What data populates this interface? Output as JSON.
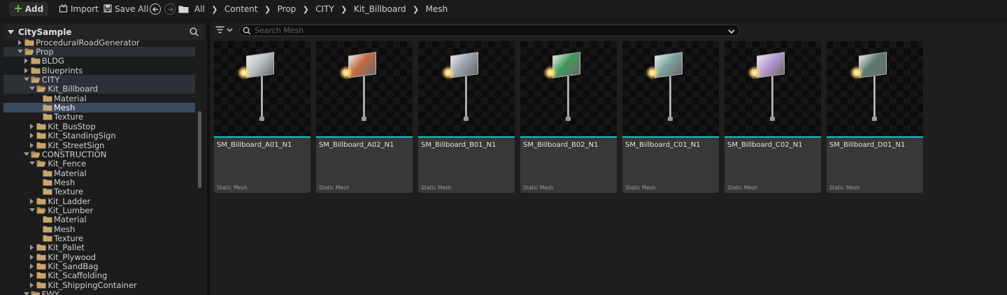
{
  "toolbar": {
    "add_label": "Add",
    "import_label": "Import",
    "save_all_label": "Save All"
  },
  "breadcrumb": [
    "All",
    "Content",
    "Prop",
    "CITY",
    "Kit_Billboard",
    "Mesh"
  ],
  "tree": {
    "title": "CitySample",
    "rows": [
      {
        "label": "ProceduralRoadGenerator",
        "indent": 2,
        "expanded": false,
        "state": ""
      },
      {
        "label": "Prop",
        "indent": 2,
        "expanded": true,
        "state": "sel-light"
      },
      {
        "label": "BLDG",
        "indent": 3,
        "expanded": false,
        "state": ""
      },
      {
        "label": "Blueprints",
        "indent": 3,
        "expanded": false,
        "state": ""
      },
      {
        "label": "CITY",
        "indent": 3,
        "expanded": true,
        "state": "sel-light"
      },
      {
        "label": "Kit_Billboard",
        "indent": 4,
        "expanded": true,
        "state": "sel-light"
      },
      {
        "label": "Material",
        "indent": 5,
        "leaf": true,
        "state": ""
      },
      {
        "label": "Mesh",
        "indent": 5,
        "leaf": true,
        "state": "sel"
      },
      {
        "label": "Texture",
        "indent": 5,
        "leaf": true,
        "state": ""
      },
      {
        "label": "Kit_BusStop",
        "indent": 4,
        "expanded": false,
        "state": ""
      },
      {
        "label": "Kit_StandingSign",
        "indent": 4,
        "expanded": false,
        "state": ""
      },
      {
        "label": "Kit_StreetSign",
        "indent": 4,
        "expanded": false,
        "state": ""
      },
      {
        "label": "CONSTRUCTION",
        "indent": 3,
        "expanded": true,
        "state": ""
      },
      {
        "label": "Kit_Fence",
        "indent": 4,
        "expanded": true,
        "state": ""
      },
      {
        "label": "Material",
        "indent": 5,
        "leaf": true,
        "state": ""
      },
      {
        "label": "Mesh",
        "indent": 5,
        "leaf": true,
        "state": ""
      },
      {
        "label": "Texture",
        "indent": 5,
        "leaf": true,
        "state": ""
      },
      {
        "label": "Kit_Ladder",
        "indent": 4,
        "expanded": false,
        "state": ""
      },
      {
        "label": "Kit_Lumber",
        "indent": 4,
        "expanded": true,
        "state": ""
      },
      {
        "label": "Material",
        "indent": 5,
        "leaf": true,
        "state": ""
      },
      {
        "label": "Mesh",
        "indent": 5,
        "leaf": true,
        "state": ""
      },
      {
        "label": "Texture",
        "indent": 5,
        "leaf": true,
        "state": ""
      },
      {
        "label": "Kit_Pallet",
        "indent": 4,
        "expanded": false,
        "state": ""
      },
      {
        "label": "Kit_Plywood",
        "indent": 4,
        "expanded": false,
        "state": ""
      },
      {
        "label": "Kit_SandBag",
        "indent": 4,
        "expanded": false,
        "state": ""
      },
      {
        "label": "Kit_Scaffolding",
        "indent": 4,
        "expanded": false,
        "state": ""
      },
      {
        "label": "Kit_ShippingContainer",
        "indent": 4,
        "expanded": false,
        "state": ""
      },
      {
        "label": "FWY",
        "indent": 3,
        "expanded": true,
        "state": ""
      }
    ]
  },
  "search": {
    "placeholder": "Search Mesh"
  },
  "assets": [
    {
      "name": "SM_Billboard_A01_N1",
      "type": "Static Mesh",
      "board_color": "#b9c2c6"
    },
    {
      "name": "SM_Billboard_A02_N1",
      "type": "Static Mesh",
      "board_color": "#c46a3c"
    },
    {
      "name": "SM_Billboard_B01_N1",
      "type": "Static Mesh",
      "board_color": "#9aa3ad"
    },
    {
      "name": "SM_Billboard_B02_N1",
      "type": "Static Mesh",
      "board_color": "#3f9a5a"
    },
    {
      "name": "SM_Billboard_C01_N1",
      "type": "Static Mesh",
      "board_color": "#7aa6a0"
    },
    {
      "name": "SM_Billboard_C02_N1",
      "type": "Static Mesh",
      "board_color": "#b99ad4"
    },
    {
      "name": "SM_Billboard_D01_N1",
      "type": "Static Mesh",
      "board_color": "#5c7a6e"
    }
  ],
  "colors": {
    "accent": "#1fc0c6",
    "selection": "#3b4a5e",
    "folder": "#c8a56a"
  }
}
